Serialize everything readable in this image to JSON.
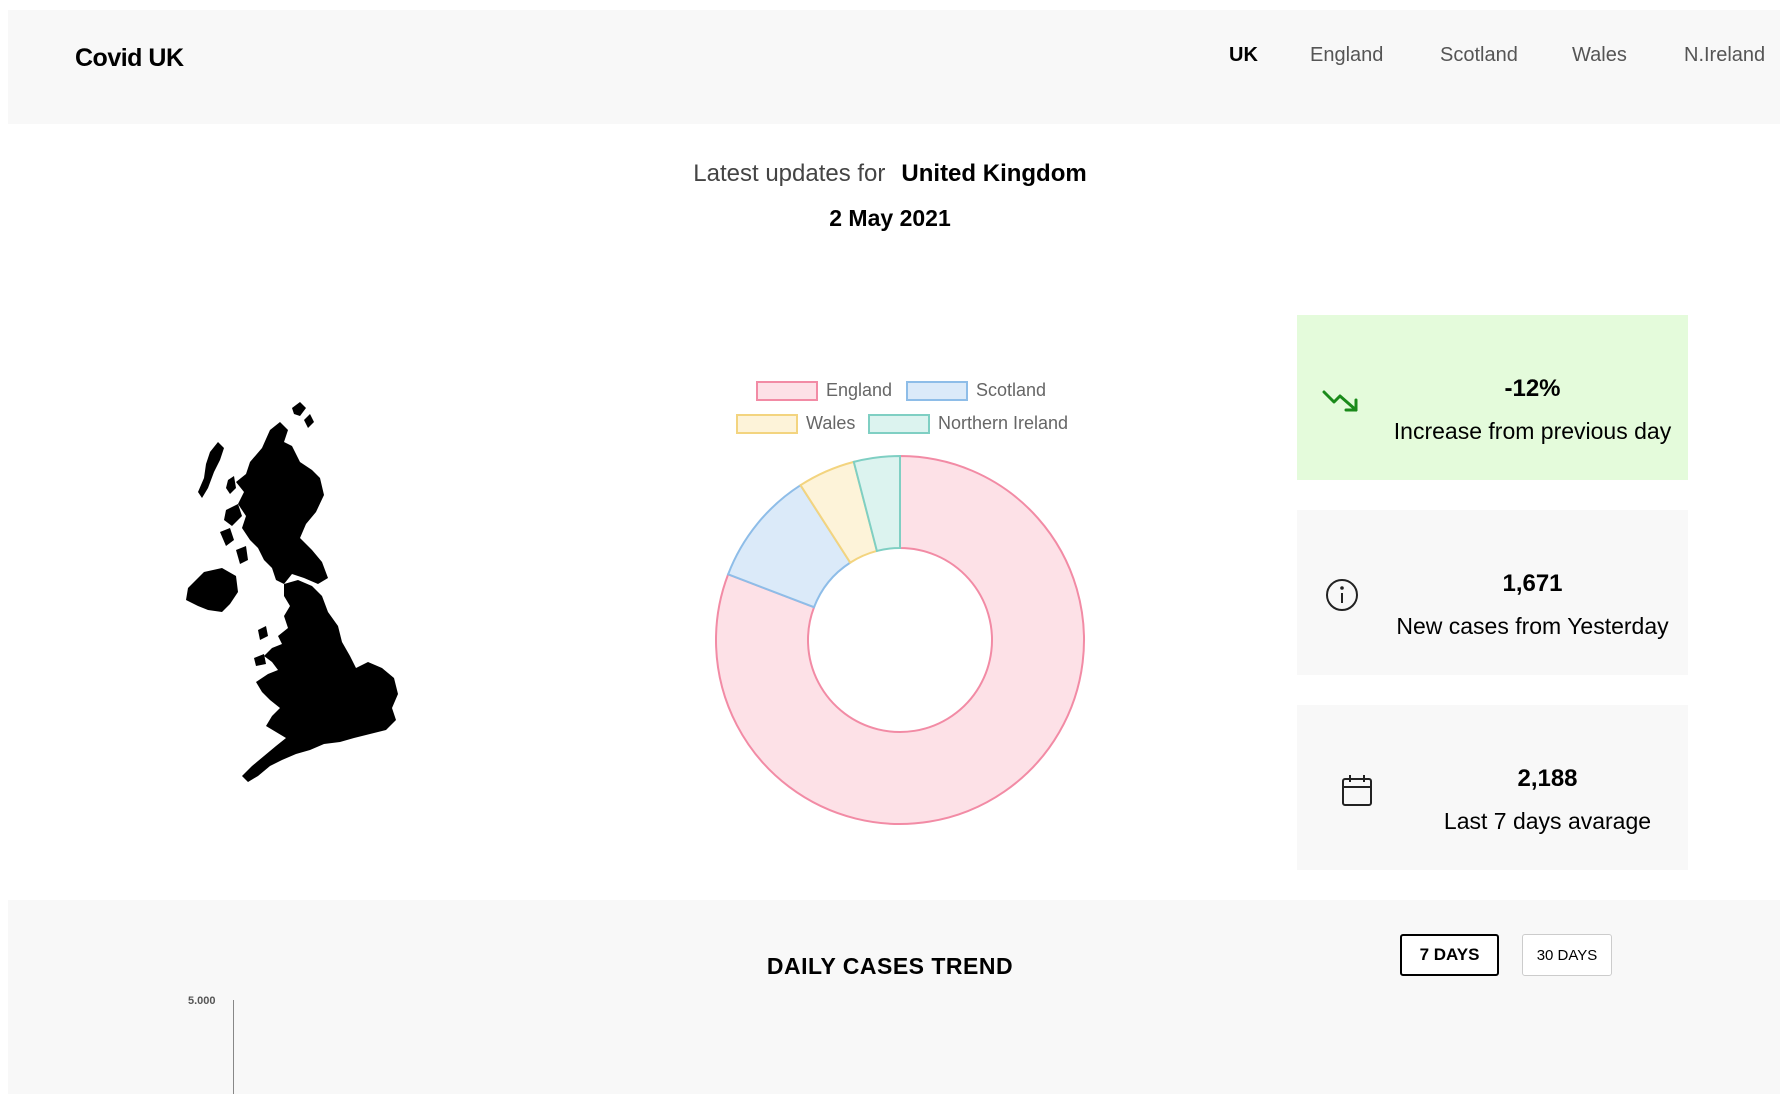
{
  "header": {
    "brand": "Covid UK",
    "nav": [
      {
        "label": "UK",
        "active": true
      },
      {
        "label": "England",
        "active": false
      },
      {
        "label": "Scotland",
        "active": false
      },
      {
        "label": "Wales",
        "active": false
      },
      {
        "label": "N.Ireland",
        "active": false
      }
    ]
  },
  "summary": {
    "prefix": "Latest updates for",
    "place": "United Kingdom",
    "date": "2 May 2021"
  },
  "map": {
    "icon": "uk-map-icon",
    "color": "#000000"
  },
  "chart_data": {
    "type": "pie",
    "variant": "doughnut",
    "categories": [
      "England",
      "Scotland",
      "Wales",
      "Northern Ireland"
    ],
    "values": [
      80,
      10,
      5,
      4
    ],
    "legend_position": "top",
    "colors": [
      {
        "fill": "#fde1e7",
        "stroke": "#f28ba5"
      },
      {
        "fill": "#dbeaf9",
        "stroke": "#8ebde8"
      },
      {
        "fill": "#fdf3d9",
        "stroke": "#f3d47f"
      },
      {
        "fill": "#dcf3ef",
        "stroke": "#7fcfc3"
      }
    ]
  },
  "stats": [
    {
      "value": "-12%",
      "label": "Increase from previous day",
      "icon": "trending-down-icon",
      "color": "#e4fbdb",
      "icon_color": "#1a8a1a"
    },
    {
      "value": "1,671",
      "label": "New cases from Yesterday",
      "icon": "info-icon",
      "color": "#f8f8f8"
    },
    {
      "value": "2,188",
      "label": "Last 7 days avarage",
      "icon": "calendar-icon",
      "color": "#f8f8f8"
    }
  ],
  "trend": {
    "title": "DAILY CASES TREND",
    "buttons": [
      "7 DAYS",
      "30 DAYS"
    ],
    "active_button": "7 DAYS",
    "y_tick": "5.000"
  }
}
